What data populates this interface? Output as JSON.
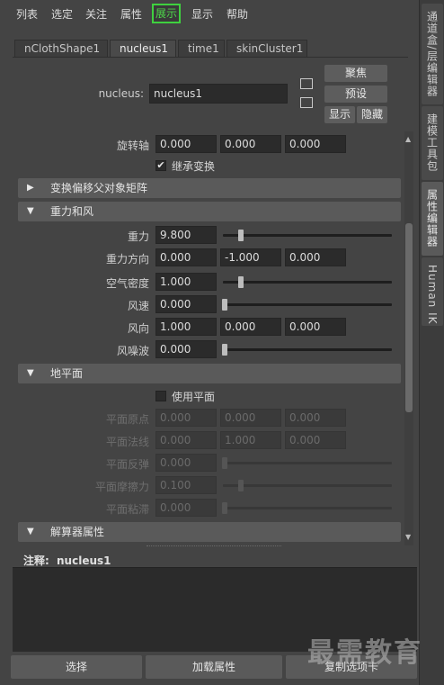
{
  "menubar": {
    "items": [
      "列表",
      "选定",
      "关注",
      "属性",
      "展示",
      "显示",
      "帮助"
    ],
    "active_index": 4
  },
  "side_tabs": [
    "通道盒/层编辑器",
    "建模工具包",
    "属性编辑器",
    "Human IK"
  ],
  "side_tab_active": 2,
  "node_tabs": [
    "nClothShape1",
    "nucleus1",
    "time1",
    "skinCluster1"
  ],
  "node_tab_active": 1,
  "header": {
    "node_label": "nucleus:",
    "node_value": "nucleus1",
    "focus_btn": "聚焦",
    "preset_btn": "预设",
    "show_btn": "显示",
    "hide_btn": "隐藏"
  },
  "rotate_axis": {
    "label": "旋转轴",
    "values": [
      "0.000",
      "0.000",
      "0.000"
    ]
  },
  "inherit_transform": {
    "label": "继承变换",
    "checked": true
  },
  "sections": {
    "transform_offset": {
      "title": "变换偏移父对象矩阵",
      "expanded": false
    },
    "gravity_wind": {
      "title": "重力和风",
      "expanded": true
    },
    "ground_plane": {
      "title": "地平面",
      "expanded": true
    },
    "solver_attrs": {
      "title": "解算器属性",
      "expanded": true
    }
  },
  "gravity_wind": {
    "gravity": {
      "label": "重力",
      "value": "9.800",
      "slider_fraction": 0.12
    },
    "gravity_dir": {
      "label": "重力方向",
      "values": [
        "0.000",
        "-1.000",
        "0.000"
      ]
    },
    "air_density": {
      "label": "空气密度",
      "value": "1.000",
      "slider_fraction": 0.12
    },
    "wind_speed": {
      "label": "风速",
      "value": "0.000",
      "slider_fraction": 0.0
    },
    "wind_dir": {
      "label": "风向",
      "values": [
        "1.000",
        "0.000",
        "0.000"
      ]
    },
    "wind_noise": {
      "label": "风噪波",
      "value": "0.000",
      "slider_fraction": 0.0
    }
  },
  "ground_plane": {
    "use_plane": {
      "label": "使用平面",
      "checked": false
    },
    "plane_origin": {
      "label": "平面原点",
      "values": [
        "0.000",
        "0.000",
        "0.000"
      ]
    },
    "plane_normal": {
      "label": "平面法线",
      "values": [
        "0.000",
        "1.000",
        "0.000"
      ]
    },
    "plane_bounce": {
      "label": "平面反弹",
      "value": "0.000",
      "slider_fraction": 0.0
    },
    "plane_friction": {
      "label": "平面摩擦力",
      "value": "0.100",
      "slider_fraction": 0.1
    },
    "plane_stickiness": {
      "label": "平面粘滞",
      "value": "0.000",
      "slider_fraction": 0.0
    }
  },
  "notes": {
    "label": "注释:",
    "node": "nucleus1"
  },
  "bottom": {
    "select": "选择",
    "load_attrs": "加载属性",
    "copy_tab": "复制选项卡"
  },
  "watermark": "最需教育",
  "colors": {
    "active_menu": "#3fd13f",
    "section_bg": "#5a5a5a",
    "field_bg": "#2b2b2b"
  }
}
